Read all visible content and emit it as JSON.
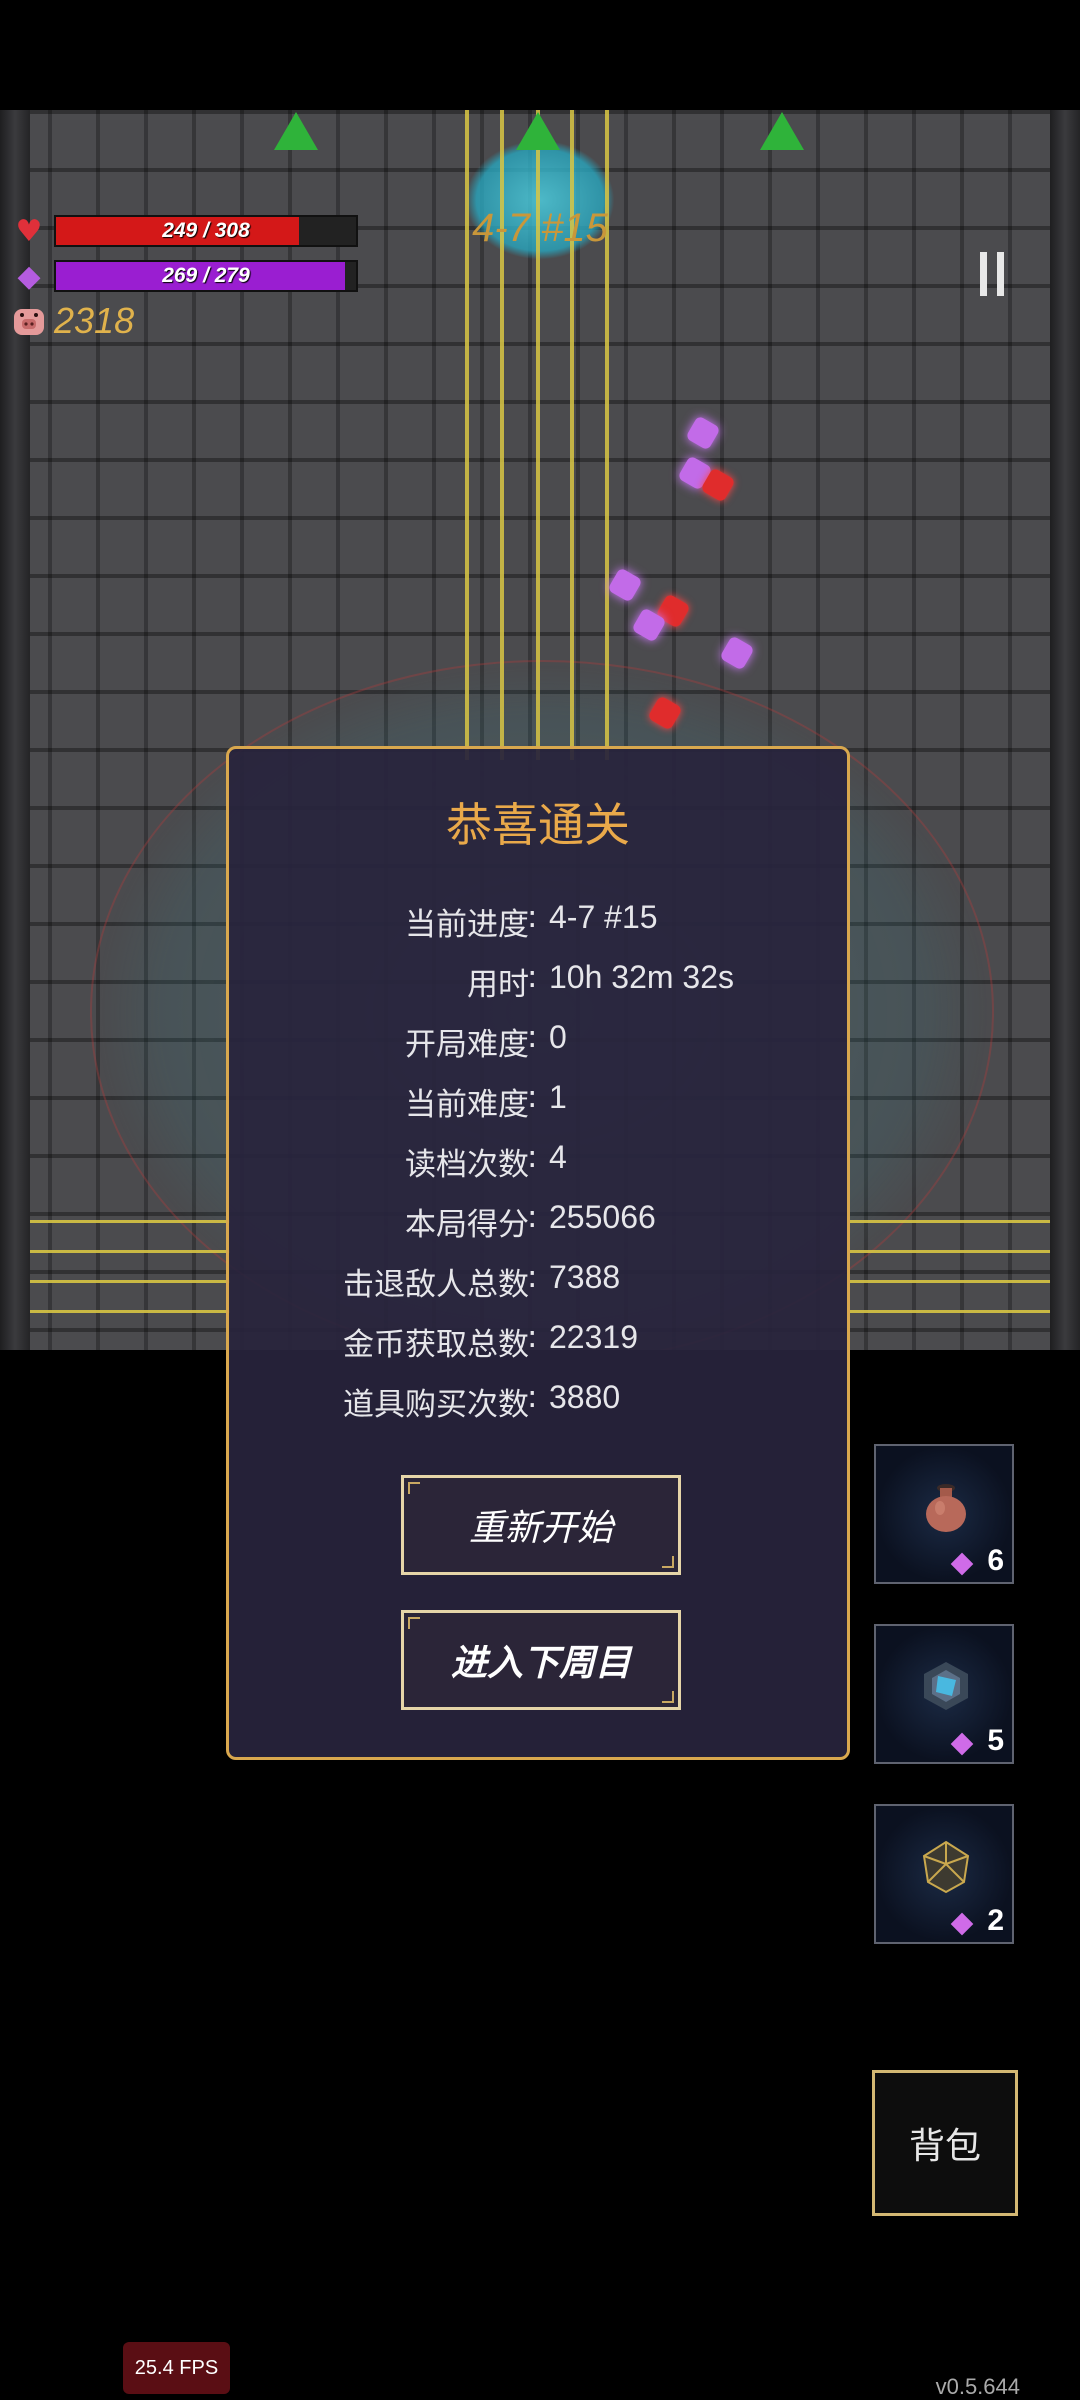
{
  "hud": {
    "hp": {
      "current": 249,
      "max": 308,
      "text": "249 / 308",
      "color": "#d41818"
    },
    "mp": {
      "current": 269,
      "max": 279,
      "text": "269 / 279",
      "color": "#9a1ed1"
    },
    "gold": "2318",
    "level": "4-7 #15",
    "icons": {
      "hp": "heart-icon",
      "mp": "mana-crystal-icon",
      "gold": "pig-icon",
      "pause": "pause-icon"
    }
  },
  "dialog": {
    "title": "恭喜通关",
    "stats": [
      {
        "label": "当前进度",
        "value": "4-7 #15"
      },
      {
        "label": "用时",
        "value": "10h 32m 32s"
      },
      {
        "label": "开局难度",
        "value": "0"
      },
      {
        "label": "当前难度",
        "value": "1"
      },
      {
        "label": "读档次数",
        "value": "4"
      },
      {
        "label": "本局得分",
        "value": "255066"
      },
      {
        "label": "击退敌人总数",
        "value": "7388"
      },
      {
        "label": "金币获取总数",
        "value": "22319"
      },
      {
        "label": "道具购买次数",
        "value": "3880"
      }
    ],
    "colon": ":",
    "restart_label": "重新开始",
    "next_cycle_label": "进入下周目"
  },
  "items": [
    {
      "icon": "potion-jar-icon",
      "count": "6"
    },
    {
      "icon": "crystal-orb-icon",
      "count": "5"
    },
    {
      "icon": "icosahedron-icon",
      "count": "2"
    }
  ],
  "bag_label": "背包",
  "fps": "25.4 FPS",
  "version": "v0.5.644",
  "colors": {
    "accent": "#d9a84e",
    "title": "#e9a94a",
    "dialog_bg": "#28243c"
  }
}
